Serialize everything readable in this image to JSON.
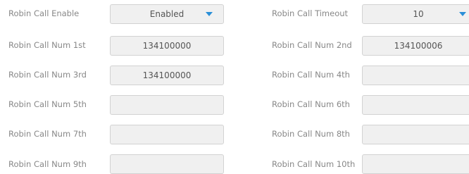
{
  "fields": [
    {
      "label": "Robin Call Enable",
      "value": "Enabled",
      "type": "select",
      "caret_icon": "caret-down-icon"
    },
    {
      "label": "Robin Call Timeout",
      "value": "10",
      "type": "select",
      "caret_icon": "caret-down-icon"
    },
    {
      "label": "Robin Call Num 1st",
      "value": "134100000",
      "type": "text"
    },
    {
      "label": "Robin Call Num 2nd",
      "value": "134100006",
      "type": "text"
    },
    {
      "label": "Robin Call Num 3rd",
      "value": "134100000",
      "type": "text"
    },
    {
      "label": "Robin Call Num 4th",
      "value": "",
      "type": "text"
    },
    {
      "label": "Robin Call Num 5th",
      "value": "",
      "type": "text"
    },
    {
      "label": "Robin Call Num 6th",
      "value": "",
      "type": "text"
    },
    {
      "label": "Robin Call Num 7th",
      "value": "",
      "type": "text"
    },
    {
      "label": "Robin Call Num 8th",
      "value": "",
      "type": "text"
    },
    {
      "label": "Robin Call Num 9th",
      "value": "",
      "type": "text"
    },
    {
      "label": "Robin Call Num 10th",
      "value": "",
      "type": "text"
    }
  ],
  "colors": {
    "label_text": "#888888",
    "field_background": "#f0f0f0",
    "field_border": "#d2d2d2",
    "field_text": "#555555",
    "caret": "#2a8fd8"
  }
}
